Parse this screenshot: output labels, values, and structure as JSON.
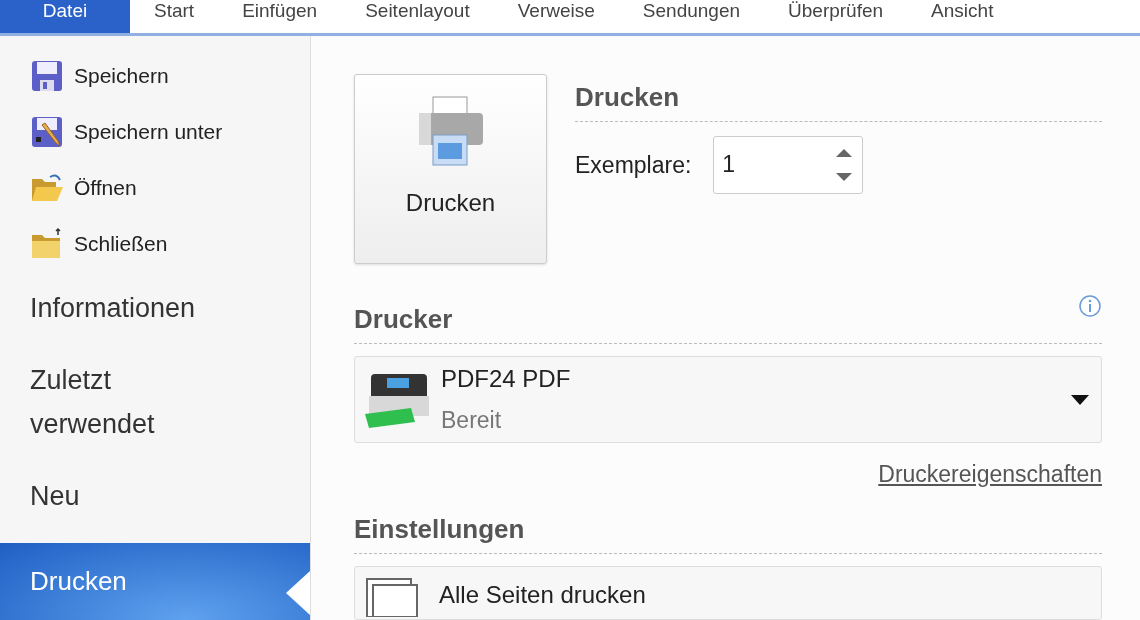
{
  "ribbon_tabs": [
    {
      "label": "Datei",
      "selected": true
    },
    {
      "label": "Start",
      "selected": false
    },
    {
      "label": "Einfügen",
      "selected": false
    },
    {
      "label": "Seitenlayout",
      "selected": false
    },
    {
      "label": "Verweise",
      "selected": false
    },
    {
      "label": "Sendungen",
      "selected": false
    },
    {
      "label": "Überprüfen",
      "selected": false
    },
    {
      "label": "Ansicht",
      "selected": false
    }
  ],
  "sidebar": {
    "items": [
      {
        "kind": "command",
        "label": "Speichern"
      },
      {
        "kind": "command",
        "label": "Speichern unter"
      },
      {
        "kind": "command",
        "label": "Öffnen"
      },
      {
        "kind": "command",
        "label": "Schließen"
      },
      {
        "kind": "section",
        "label": "Informationen",
        "selected": false
      },
      {
        "kind": "section",
        "label": "Zuletzt verwendet",
        "selected": false
      },
      {
        "kind": "section",
        "label": "Neu",
        "selected": false
      },
      {
        "kind": "section",
        "label": "Drucken",
        "selected": true
      }
    ]
  },
  "print": {
    "button": "Drucken",
    "heading": "Drucken",
    "copies_label": "Exemplare:",
    "copies_value": "1"
  },
  "printer": {
    "heading": "Drucker",
    "name": "PDF24 PDF",
    "status": "Bereit",
    "properties_link": "Druckereigenschaften"
  },
  "settings": {
    "heading": "Einstellungen",
    "first_option": "Alle Seiten drucken"
  }
}
